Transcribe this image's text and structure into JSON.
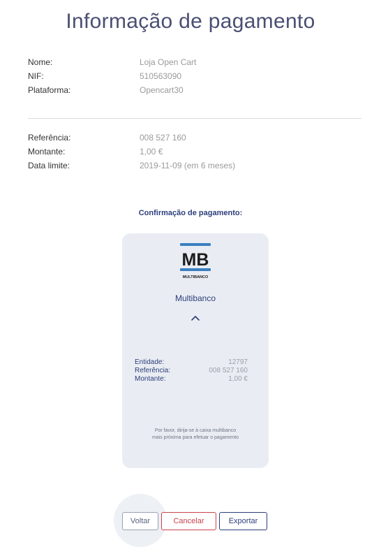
{
  "page": {
    "title": "Informação de pagamento"
  },
  "merchant": {
    "name_label": "Nome:",
    "name_value": "Loja Open Cart",
    "nif_label": "NIF:",
    "nif_value": "510563090",
    "platform_label": "Plataforma:",
    "platform_value": "Opencart30"
  },
  "payment": {
    "reference_label": "Referência:",
    "reference_value": "008 527 160",
    "amount_label": "Montante:",
    "amount_value": "1,00 €",
    "deadline_label": "Data limite:",
    "deadline_value": "2019-11-09 (em 6 meses)"
  },
  "confirmation": {
    "heading": "Confirmação de pagamento:",
    "logo_text": "MB",
    "logo_subtext": "MULTIBANCO",
    "method_name": "Multibanco",
    "entity_label": "Entidade:",
    "entity_value": "12797",
    "reference_label": "Referência:",
    "reference_value": "008 527 160",
    "amount_label": "Montante:",
    "amount_value": "1,00 €",
    "note_line1": "Por favor, dirija-se à caixa multibanco",
    "note_line2": "mais próxima para efetuar o pagamento",
    "expand_icon": "chevron-up-icon"
  },
  "actions": {
    "back_label": "Voltar",
    "cancel_label": "Cancelar",
    "export_label": "Exportar"
  },
  "colors": {
    "title": "#4a4f73",
    "brand_blue": "#2c3e7a",
    "cancel_red": "#c9444c",
    "card_bg": "#e9edf3",
    "mb_logo_blue": "#3a7fc1"
  }
}
